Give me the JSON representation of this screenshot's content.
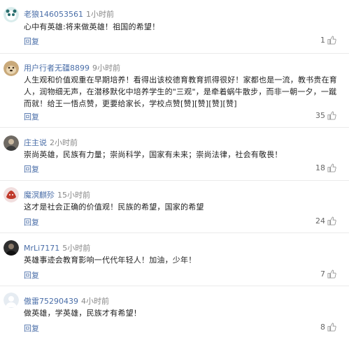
{
  "comments": [
    {
      "user": "老狼146053561",
      "time": "1小时前",
      "text": "心中有英雄:将来做英雄！祖国的希望！",
      "reply_label": "回复",
      "likes": "1",
      "avatar_icon": "panda-avatar-icon"
    },
    {
      "user": "用户行者无疆8899",
      "time": "9小时前",
      "text": "人生观和价值观重在早期培养！看得出该校德育教育抓得很好！家都也是一流，教书贵在育人，润物细无声，在潜移默化中培养学生的\"三观\"，是牵着蜗牛散步，而非一朝一夕，一蹴而就！给王一悟点赞，更要给家长，学校点赞[赞][赞][赞][赞]",
      "reply_label": "回复",
      "likes": "35",
      "avatar_icon": "dog-avatar-icon"
    },
    {
      "user": "庄主说",
      "time": "2小时前",
      "text": "崇尚英雄，民族有力量；崇尚科学，国家有未来；崇尚法律，社会有敬畏！",
      "reply_label": "回复",
      "likes": "18",
      "avatar_icon": "person-avatar-icon"
    },
    {
      "user": "魔溟麒殄",
      "time": "15小时前",
      "text": "这才是社会正确的价值观！民族的希望，国家的希望",
      "reply_label": "回复",
      "likes": "24",
      "avatar_icon": "red-character-avatar-icon"
    },
    {
      "user": "MrLi7171",
      "time": "5小时前",
      "text": "英雄事迹会教育影响一代代年轻人！加油，少年！",
      "reply_label": "回复",
      "likes": "7",
      "avatar_icon": "dark-person-avatar-icon"
    },
    {
      "user": "傲雷75290439",
      "time": "4小时前",
      "text": "做英雄，学英雄，民族才有希望！",
      "reply_label": "回复",
      "likes": "8",
      "avatar_icon": "default-avatar-icon"
    }
  ]
}
